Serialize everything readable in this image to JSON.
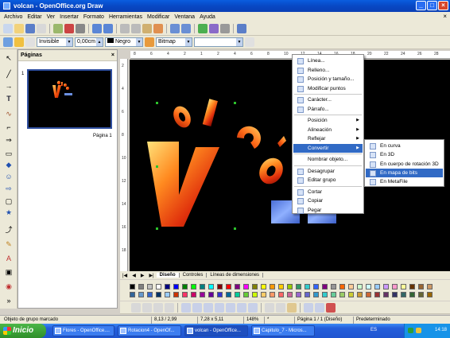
{
  "window": {
    "title": "volcan - OpenOffice.org Draw",
    "min": "_",
    "max": "□",
    "close": "×"
  },
  "menubar": {
    "items": [
      "Archivo",
      "Editar",
      "Ver",
      "Insertar",
      "Formato",
      "Herramientas",
      "Modificar",
      "Ventana",
      "Ayuda"
    ],
    "doc_close": "×"
  },
  "toolbar2": {
    "line_style": "Invisible",
    "line_width": "0,00cm",
    "line_color": "Negro",
    "area_style": "Bitmap",
    "area_value": ""
  },
  "pages_panel": {
    "title": "Páginas",
    "close": "×",
    "page_number": "1",
    "page_label": "Página 1"
  },
  "hruler": [
    "8",
    "6",
    "4",
    "2",
    "1",
    "2",
    "4",
    "6",
    "8",
    "10",
    "12",
    "14",
    "16",
    "18",
    "20",
    "22",
    "24",
    "26",
    "28"
  ],
  "vruler": [
    "2",
    "4",
    "6",
    "8",
    "10",
    "12",
    "14",
    "16",
    "18"
  ],
  "canvas": {
    "artwork": [
      "V",
      "o",
      "l",
      "c",
      "á"
    ]
  },
  "context_menu": {
    "items": [
      {
        "label": "Línea...",
        "icon": "line-icon"
      },
      {
        "label": "Relleno...",
        "icon": "fill-icon"
      },
      {
        "label": "Posición y tamaño...",
        "icon": "position-size-icon"
      },
      {
        "label": "Modificar puntos",
        "icon": "points-icon"
      },
      {
        "label": "Carácter...",
        "icon": "character-icon"
      },
      {
        "label": "Párrafo...",
        "icon": "paragraph-icon"
      },
      {
        "label": "Posición",
        "submenu": true
      },
      {
        "label": "Alineación",
        "submenu": true
      },
      {
        "label": "Reflejar",
        "submenu": true
      },
      {
        "label": "Convertir",
        "submenu": true,
        "highlighted": true
      },
      {
        "label": "Nombrar objeto..."
      },
      {
        "label": "Desagrupar",
        "icon": "ungroup-icon"
      },
      {
        "label": "Editar grupo",
        "icon": "edit-group-icon"
      },
      {
        "label": "Cortar",
        "icon": "cut-icon"
      },
      {
        "label": "Copiar",
        "icon": "copy-icon"
      },
      {
        "label": "Pegar",
        "icon": "paste-icon"
      }
    ]
  },
  "submenu": {
    "items": [
      {
        "label": "En curva",
        "icon": "curve-icon"
      },
      {
        "label": "En 3D",
        "icon": "3d-icon"
      },
      {
        "label": "En cuerpo de rotación 3D",
        "icon": "rotation-body-icon"
      },
      {
        "label": "En mapa de bits",
        "icon": "bitmap-icon",
        "highlighted": true
      },
      {
        "label": "En MetaFile",
        "icon": "metafile-icon"
      }
    ]
  },
  "tabs": [
    "Diseño",
    "Controles",
    "Líneas de dimensiones"
  ],
  "statusbar": {
    "message": "Objeto de grupo marcado",
    "position": "8,13 / 2,99",
    "size": "7,28 x 5,11",
    "zoom": "148%",
    "modified": "*",
    "page": "Página 1 / 1 (Diseño)",
    "layout": "Predeterminado"
  },
  "taskbar": {
    "start": "Inicio",
    "tasks": [
      "Flores - OpenOffice....",
      "Rotacion4 - OpenOf...",
      "volcan - OpenOffice...",
      "Capitulo_7 - Micros..."
    ],
    "lang": "ES",
    "clock": "14:18"
  },
  "palette_colors": [
    "#000000",
    "#808080",
    "#c0c0c0",
    "#ffffff",
    "#000080",
    "#0000ff",
    "#008000",
    "#00ff00",
    "#008080",
    "#00ffff",
    "#800000",
    "#ff0000",
    "#800080",
    "#ff00ff",
    "#808000",
    "#ffff00",
    "#ff9900",
    "#ffcc00",
    "#99cc00",
    "#339966",
    "#33cccc",
    "#3366ff",
    "#800080",
    "#969696",
    "#ff6600",
    "#ffcc99",
    "#ccffcc",
    "#ccffff",
    "#99ccff",
    "#cc99ff",
    "#ff99cc",
    "#ffff99",
    "#663300",
    "#996633",
    "#cc9966",
    "#336699",
    "#6699cc",
    "#3366cc",
    "#003366",
    "#99ccff",
    "#cc3300",
    "#ff3366",
    "#cc0066",
    "#990099",
    "#660099",
    "#3333cc",
    "#006699",
    "#00cc99",
    "#66cc33",
    "#ccff00",
    "#ffcc66",
    "#ff9966",
    "#ff6666",
    "#cc6699",
    "#9966cc",
    "#6666cc",
    "#3399cc",
    "#33cccc",
    "#66cc99",
    "#99cc66",
    "#cccc33",
    "#cc9933",
    "#cc6633",
    "#993333",
    "#663366",
    "#333366",
    "#336666",
    "#336633",
    "#666633",
    "#996600"
  ]
}
